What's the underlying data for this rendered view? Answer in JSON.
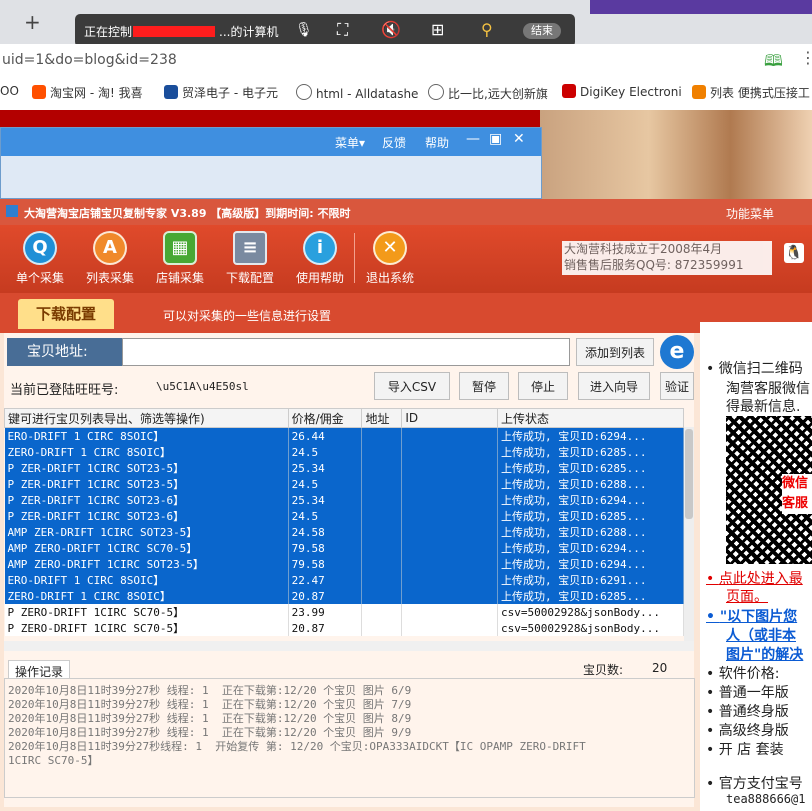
{
  "browser": {
    "remote_text_prefix": "正在控制",
    "remote_text_suffix": "...的计算机",
    "remote_end": "结束",
    "url": "uid=1&do=blog&id=238",
    "new_tab_glyph": "+",
    "bookmarks": [
      {
        "label": "OO",
        "color": "#ffffff"
      },
      {
        "label": "淘宝网 - 淘! 我喜",
        "color": "#ff5000"
      },
      {
        "label": "贸泽电子 - 电子元",
        "color": "#1a4e9b"
      },
      {
        "label": "html - Alldatashe",
        "color": "#666666"
      },
      {
        "label": "比一比,远大创新旗",
        "color": "#666666"
      },
      {
        "label": "DigiKey Electroni",
        "color": "#cc0000"
      },
      {
        "label": "列表 便携式压接工",
        "color": "#f08000"
      }
    ]
  },
  "bgwindow": {
    "menu": "菜单▾",
    "feedback": "反馈",
    "help": "帮助"
  },
  "app": {
    "title": "大淘营淘宝店铺宝贝复制专家 V3.89 【高级版】到期时间: 不限时",
    "func_menu": "功能菜单",
    "toolbar": [
      {
        "label": "单个采集",
        "glyph": "Q",
        "color": "#1f8fd6"
      },
      {
        "label": "列表采集",
        "glyph": "A",
        "color": "#f0892b"
      },
      {
        "label": "店铺采集",
        "glyph": "▦",
        "color": "#47a834"
      },
      {
        "label": "下载配置",
        "glyph": "≡",
        "color": "#7a8aa0"
      },
      {
        "label": "使用帮助",
        "glyph": "i",
        "color": "#2aa0de"
      },
      {
        "label": "退出系统",
        "glyph": "✕",
        "color": "#f39a1a"
      }
    ],
    "company_line1": "大淘营科技成立于2008年4月",
    "company_line2": "销售售后服务QQ号: 872359991",
    "section_tab": "下载配置",
    "section_desc": "可以对采集的一些信息进行设置",
    "address_label": "宝贝地址:",
    "address_value": "",
    "add_to_list": "添加到列表",
    "login_label": "当前已登陆旺旺号:",
    "login_value": "\\u5C1A\\u4E50sl",
    "btn_import_csv": "导入CSV",
    "btn_pause": "暂停",
    "btn_stop": "停止",
    "btn_wizard": "进入向导",
    "btn_verify": "验证",
    "columns": [
      "键可进行宝贝列表导出、筛选等操作)",
      "价格/佣金",
      "地址",
      "ID",
      "上传状态"
    ],
    "rows": [
      {
        "name": "ERO-DRIFT 1 CIRC 8SOIC】",
        "price": "26.44",
        "status": "上传成功, 宝贝ID:6294...",
        "sel": true
      },
      {
        "name": "ZERO-DRIFT 1 CIRC 8SOIC】",
        "price": "24.5",
        "status": "上传成功, 宝贝ID:6285...",
        "sel": true
      },
      {
        "name": "P ZER-DRIFT 1CIRC SOT23-5】",
        "price": "25.34",
        "status": "上传成功, 宝贝ID:6285...",
        "sel": true
      },
      {
        "name": "P ZER-DRIFT 1CIRC SOT23-5】",
        "price": "24.5",
        "status": "上传成功, 宝贝ID:6288...",
        "sel": true
      },
      {
        "name": "P ZER-DRIFT 1CIRC SOT23-6】",
        "price": "25.34",
        "status": "上传成功, 宝贝ID:6294...",
        "sel": true
      },
      {
        "name": "P ZER-DRIFT 1CIRC SOT23-6】",
        "price": "24.5",
        "status": "上传成功, 宝贝ID:6285...",
        "sel": true
      },
      {
        "name": "AMP ZER-DRIFT 1CIRC SOT23-5】",
        "price": "24.58",
        "status": "上传成功, 宝贝ID:6288...",
        "sel": true
      },
      {
        "name": "AMP ZERO-DRIFT 1CIRC SC70-5】",
        "price": "79.58",
        "status": "上传成功, 宝贝ID:6294...",
        "sel": true
      },
      {
        "name": "AMP ZERO-DRIFT 1CIRC SOT23-5】",
        "price": "79.58",
        "status": "上传成功, 宝贝ID:6294...",
        "sel": true
      },
      {
        "name": "ERO-DRIFT 1 CIRC 8SOIC】",
        "price": "22.47",
        "status": "上传成功, 宝贝ID:6291...",
        "sel": true
      },
      {
        "name": "ZERO-DRIFT 1 CIRC 8SOIC】",
        "price": "20.87",
        "status": "上传成功, 宝贝ID:6285...",
        "sel": true
      },
      {
        "name": "P ZERO-DRIFT 1CIRC SC70-5】",
        "price": "23.99",
        "status": "csv=50002928&jsonBody...",
        "sel": false
      },
      {
        "name": "P ZERO-DRIFT 1CIRC SC70-5】",
        "price": "20.87",
        "status": "csv=50002928&jsonBody...",
        "sel": false
      }
    ],
    "log_tab": "操作记录",
    "count_label": "宝贝数:",
    "count_value": "20",
    "log_lines": [
      "2020年10月8日11时39分27秒 线程: 1  正在下载第:12/20 个宝贝 图片 6/9",
      "2020年10月8日11时39分27秒 线程: 1  正在下载第:12/20 个宝贝 图片 7/9",
      "2020年10月8日11时39分27秒 线程: 1  正在下载第:12/20 个宝贝 图片 8/9",
      "2020年10月8日11时39分27秒 线程: 1  正在下载第:12/20 个宝贝 图片 9/9",
      "2020年10月8日11时39分27秒线程: 1  开始复传 第: 12/20 个宝贝:OPA333AIDCKT【IC OPAMP ZERO-DRIFT",
      "1CIRC SC70-5】"
    ]
  },
  "right": {
    "line1": "微信扫二维码",
    "line2": "淘营客服微信",
    "line3": "得最新信息.",
    "qr_overlay1": "微信",
    "qr_overlay2": "客服",
    "red1": "点此处进入最",
    "red2": "页面。",
    "blue1": "\"以下图片您",
    "blue2": "人（或非本",
    "blue3": "图片\"的解决",
    "price1": "软件价格:",
    "price2": "普通一年版",
    "price3": "普通终身版",
    "price4": "高级终身版",
    "price5": "开 店 套装",
    "official": "官方支付宝号",
    "email": "tea888666@1"
  },
  "colors": {
    "accent": "#d84a2f",
    "selection": "#0a66cc"
  }
}
